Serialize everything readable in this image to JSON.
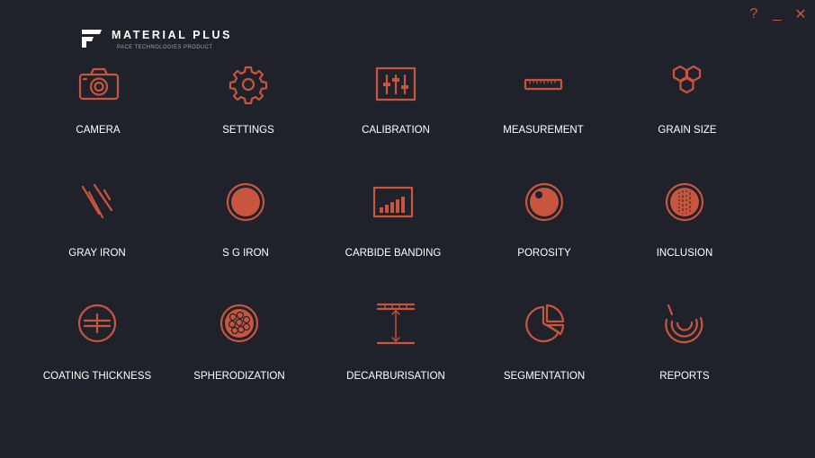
{
  "brand": {
    "title": "MATERIAL PLUS",
    "subtitle": "PACE TECHNOLOGIES PRODUCT"
  },
  "window_controls": {
    "help": "?",
    "minimize": "_",
    "close": "✕"
  },
  "colors": {
    "background": "#1f222b",
    "accent": "#c8553d",
    "text": "#ffffff"
  },
  "tiles": [
    {
      "label": "CAMERA",
      "icon": "camera-icon"
    },
    {
      "label": "SETTINGS",
      "icon": "gear-icon"
    },
    {
      "label": "CALIBRATION",
      "icon": "sliders-icon"
    },
    {
      "label": "MEASUREMENT",
      "icon": "ruler-icon"
    },
    {
      "label": "GRAIN SIZE",
      "icon": "hexagons-icon"
    },
    {
      "label": "GRAY IRON",
      "icon": "flakes-icon"
    },
    {
      "label": "S G IRON",
      "icon": "filled-circle-icon"
    },
    {
      "label": "CARBIDE BANDING",
      "icon": "bar-chart-icon"
    },
    {
      "label": "POROSITY",
      "icon": "circle-with-dot-icon"
    },
    {
      "label": "INCLUSION",
      "icon": "striped-circle-icon"
    },
    {
      "label": "COATING THICKNESS",
      "icon": "crosshair-circle-icon"
    },
    {
      "label": "SPHERODIZATION",
      "icon": "cells-circle-icon"
    },
    {
      "label": "DECARBURISATION",
      "icon": "depth-arrow-icon"
    },
    {
      "label": "SEGMENTATION",
      "icon": "pie-icon"
    },
    {
      "label": "REPORTS",
      "icon": "arcs-icon"
    }
  ]
}
